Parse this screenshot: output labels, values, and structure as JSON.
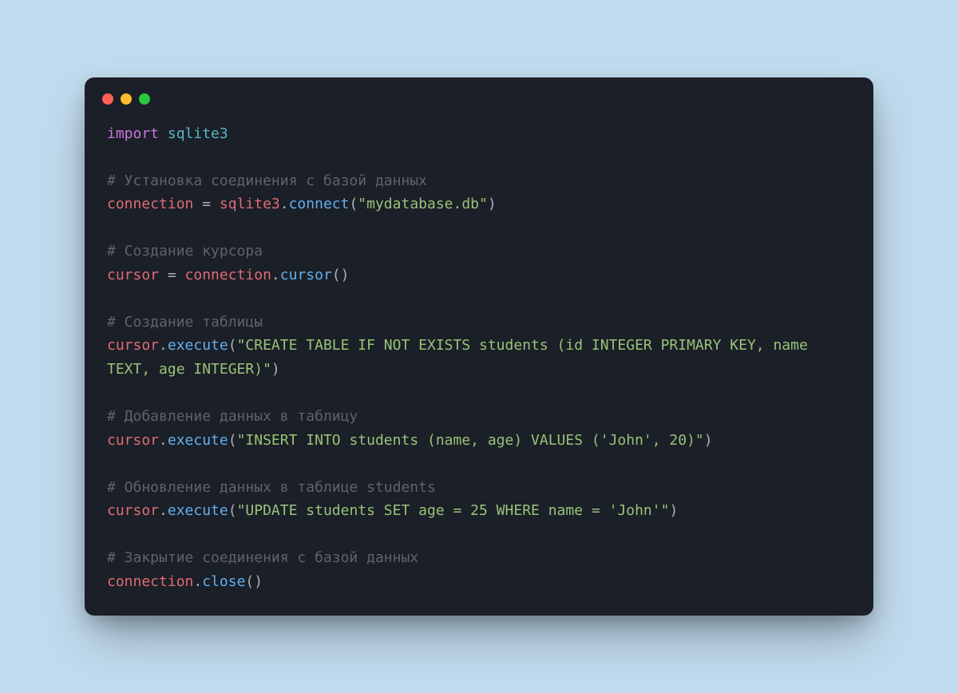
{
  "window": {
    "traffic_lights": [
      "close",
      "minimize",
      "zoom"
    ]
  },
  "code": {
    "language": "python",
    "lines": [
      {
        "tokens": [
          {
            "cls": "tok-keyword",
            "t": "import"
          },
          {
            "cls": "tok-plain",
            "t": " "
          },
          {
            "cls": "tok-module",
            "t": "sqlite3"
          }
        ]
      },
      {
        "tokens": []
      },
      {
        "tokens": [
          {
            "cls": "tok-comment",
            "t": "# Установка соединения с базой данных"
          }
        ]
      },
      {
        "tokens": [
          {
            "cls": "tok-ident",
            "t": "connection"
          },
          {
            "cls": "tok-plain",
            "t": " = "
          },
          {
            "cls": "tok-ident",
            "t": "sqlite3"
          },
          {
            "cls": "tok-plain",
            "t": "."
          },
          {
            "cls": "tok-func",
            "t": "connect"
          },
          {
            "cls": "tok-plain",
            "t": "("
          },
          {
            "cls": "tok-string",
            "t": "\"mydatabase.db\""
          },
          {
            "cls": "tok-plain",
            "t": ")"
          }
        ]
      },
      {
        "tokens": []
      },
      {
        "tokens": [
          {
            "cls": "tok-comment",
            "t": "# Создание курсора"
          }
        ]
      },
      {
        "tokens": [
          {
            "cls": "tok-ident",
            "t": "cursor"
          },
          {
            "cls": "tok-plain",
            "t": " = "
          },
          {
            "cls": "tok-ident",
            "t": "connection"
          },
          {
            "cls": "tok-plain",
            "t": "."
          },
          {
            "cls": "tok-func",
            "t": "cursor"
          },
          {
            "cls": "tok-plain",
            "t": "()"
          }
        ]
      },
      {
        "tokens": []
      },
      {
        "tokens": [
          {
            "cls": "tok-comment",
            "t": "# Создание таблицы"
          }
        ]
      },
      {
        "tokens": [
          {
            "cls": "tok-ident",
            "t": "cursor"
          },
          {
            "cls": "tok-plain",
            "t": "."
          },
          {
            "cls": "tok-func",
            "t": "execute"
          },
          {
            "cls": "tok-plain",
            "t": "("
          },
          {
            "cls": "tok-string",
            "t": "\"CREATE TABLE IF NOT EXISTS students (id INTEGER PRIMARY KEY, name TEXT, age INTEGER)\""
          },
          {
            "cls": "tok-plain",
            "t": ")"
          }
        ]
      },
      {
        "tokens": []
      },
      {
        "tokens": [
          {
            "cls": "tok-comment",
            "t": "# Добавление данных в таблицу"
          }
        ]
      },
      {
        "tokens": [
          {
            "cls": "tok-ident",
            "t": "cursor"
          },
          {
            "cls": "tok-plain",
            "t": "."
          },
          {
            "cls": "tok-func",
            "t": "execute"
          },
          {
            "cls": "tok-plain",
            "t": "("
          },
          {
            "cls": "tok-string",
            "t": "\"INSERT INTO students (name, age) VALUES ('John', 20)\""
          },
          {
            "cls": "tok-plain",
            "t": ")"
          }
        ]
      },
      {
        "tokens": []
      },
      {
        "tokens": [
          {
            "cls": "tok-comment",
            "t": "# Обновление данных в таблице students"
          }
        ]
      },
      {
        "tokens": [
          {
            "cls": "tok-ident",
            "t": "cursor"
          },
          {
            "cls": "tok-plain",
            "t": "."
          },
          {
            "cls": "tok-func",
            "t": "execute"
          },
          {
            "cls": "tok-plain",
            "t": "("
          },
          {
            "cls": "tok-string",
            "t": "\"UPDATE students SET age = 25 WHERE name = 'John'\""
          },
          {
            "cls": "tok-plain",
            "t": ")"
          }
        ]
      },
      {
        "tokens": []
      },
      {
        "tokens": [
          {
            "cls": "tok-comment",
            "t": "# Закрытие соединения с базой данных"
          }
        ]
      },
      {
        "tokens": [
          {
            "cls": "tok-ident",
            "t": "connection"
          },
          {
            "cls": "tok-plain",
            "t": "."
          },
          {
            "cls": "tok-func",
            "t": "close"
          },
          {
            "cls": "tok-plain",
            "t": "()"
          }
        ]
      }
    ]
  }
}
